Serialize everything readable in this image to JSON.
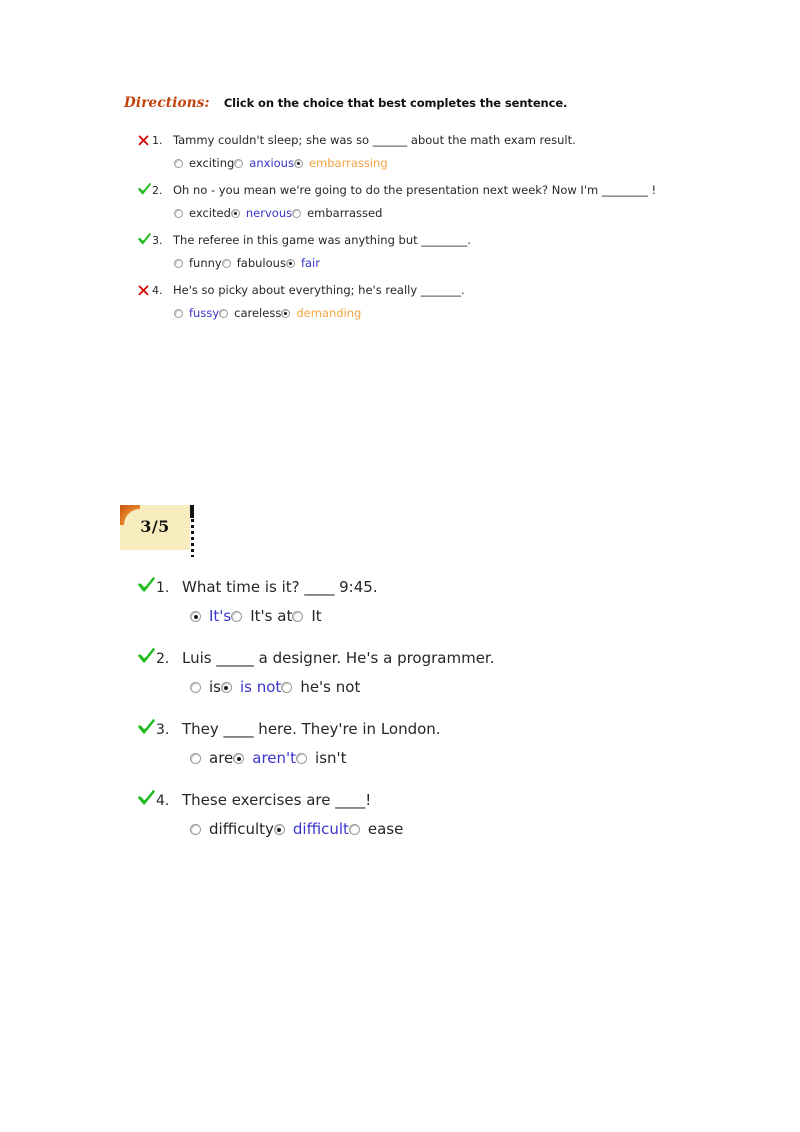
{
  "directions": {
    "label": "Directions:",
    "text": "Click on the choice that best completes the sentence."
  },
  "colors": {
    "directions_label": "#c0400a",
    "correct_answer": "#3a35cc",
    "wrong_answer": "#f5a442",
    "check_mark": "#22bb22",
    "cross_mark": "#d40000",
    "badge_background": "#f7edbe",
    "badge_corner": "#c14f0b"
  },
  "icons": {
    "correct": "check-mark-icon",
    "incorrect": "cross-mark-icon",
    "radio": "radio-button-icon"
  },
  "section_a": {
    "questions": [
      {
        "result": "incorrect",
        "number": "1.",
        "text": "Tammy couldn't sleep; she was so ______ about the math exam result.",
        "options": [
          {
            "label": "exciting",
            "state": "normal",
            "selected": false
          },
          {
            "label": "anxious",
            "state": "correct",
            "selected": false
          },
          {
            "label": "embarrassing",
            "state": "wrong",
            "selected": true
          }
        ]
      },
      {
        "result": "correct",
        "number": "2.",
        "text": "Oh no - you mean we're going to do the presentation next week? Now I'm ________ !",
        "options": [
          {
            "label": "excited",
            "state": "normal",
            "selected": false
          },
          {
            "label": "nervous",
            "state": "correct",
            "selected": true
          },
          {
            "label": "embarrassed",
            "state": "normal",
            "selected": false
          }
        ]
      },
      {
        "result": "correct",
        "number": "3.",
        "text": "The referee in this game was anything but ________.",
        "options": [
          {
            "label": "funny",
            "state": "normal",
            "selected": false
          },
          {
            "label": "fabulous",
            "state": "normal",
            "selected": false
          },
          {
            "label": "fair",
            "state": "correct",
            "selected": true
          }
        ]
      },
      {
        "result": "incorrect",
        "number": "4.",
        "text": "He's so picky about everything; he's really _______.",
        "options": [
          {
            "label": "fussy",
            "state": "correct",
            "selected": false
          },
          {
            "label": "careless",
            "state": "normal",
            "selected": false
          },
          {
            "label": "demanding",
            "state": "wrong",
            "selected": true
          }
        ]
      }
    ]
  },
  "score_badge": {
    "value": "3/5"
  },
  "section_b": {
    "questions": [
      {
        "result": "correct",
        "number": "1.",
        "text": "What time is it? ____ 9:45.",
        "options": [
          {
            "label": "It's",
            "state": "correct",
            "selected": true
          },
          {
            "label": "It's at",
            "state": "normal",
            "selected": false
          },
          {
            "label": "It",
            "state": "normal",
            "selected": false
          }
        ]
      },
      {
        "result": "correct",
        "number": "2.",
        "text": "Luis _____ a designer. He's a programmer.",
        "options": [
          {
            "label": "is",
            "state": "normal",
            "selected": false
          },
          {
            "label": "is not",
            "state": "correct",
            "selected": true
          },
          {
            "label": "he's not",
            "state": "normal",
            "selected": false
          }
        ]
      },
      {
        "result": "correct",
        "number": "3.",
        "text": "They ____ here. They're in London.",
        "options": [
          {
            "label": "are",
            "state": "normal",
            "selected": false
          },
          {
            "label": "aren't",
            "state": "correct",
            "selected": true
          },
          {
            "label": "isn't",
            "state": "normal",
            "selected": false
          }
        ]
      },
      {
        "result": "correct",
        "number": "4.",
        "text": "These exercises are ____!",
        "options": [
          {
            "label": "difficulty",
            "state": "normal",
            "selected": false
          },
          {
            "label": "difficult",
            "state": "correct",
            "selected": true
          },
          {
            "label": "ease",
            "state": "normal",
            "selected": false
          }
        ]
      }
    ]
  }
}
